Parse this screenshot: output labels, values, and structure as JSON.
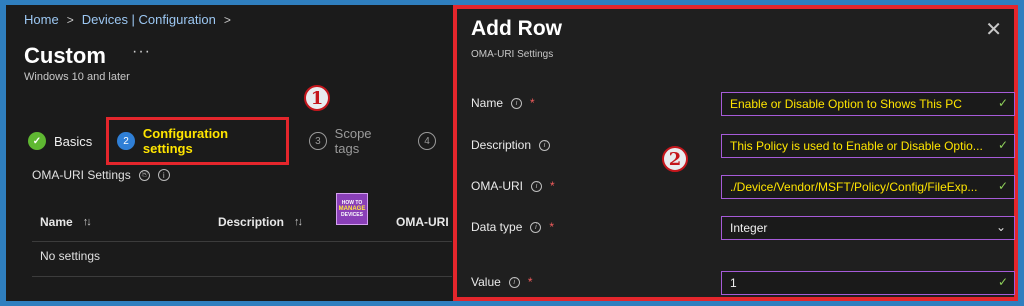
{
  "breadcrumb": [
    "Home",
    "Devices | Configuration"
  ],
  "page": {
    "title": "Custom",
    "subtitle": "Windows 10 and later"
  },
  "callouts": [
    "1",
    "2"
  ],
  "steps": [
    {
      "num": "✓",
      "label": "Basics",
      "state": "done"
    },
    {
      "num": "2",
      "label": "Configuration settings",
      "state": "active"
    },
    {
      "num": "3",
      "label": "Scope tags",
      "state": "todo"
    },
    {
      "num": "4",
      "label": "",
      "state": "todo"
    }
  ],
  "section": {
    "label": "OMA-URI Settings"
  },
  "table": {
    "headers": [
      "Name",
      "Description",
      "OMA-URI"
    ],
    "empty": "No settings"
  },
  "logo": {
    "line1": "HOW TO",
    "line2": "MANAGE",
    "line3": "DEVICES"
  },
  "panel": {
    "title": "Add Row",
    "subtitle": "OMA-URI Settings",
    "fields": [
      {
        "label": "Name",
        "required": true,
        "value": "Enable or Disable Option to Shows This PC"
      },
      {
        "label": "Description",
        "required": false,
        "value": "This Policy is used to Enable or Disable Optio..."
      },
      {
        "label": "OMA-URI",
        "required": true,
        "value": "./Device/Vendor/MSFT/Policy/Config/FileExp..."
      },
      {
        "label": "Data type",
        "required": true,
        "value": "Integer"
      },
      {
        "label": "Value",
        "required": true,
        "value": "1"
      }
    ]
  },
  "colors": {
    "accent_red": "#e4262c",
    "highlight_yellow": "#ffe500",
    "field_border": "#a65bd8"
  }
}
